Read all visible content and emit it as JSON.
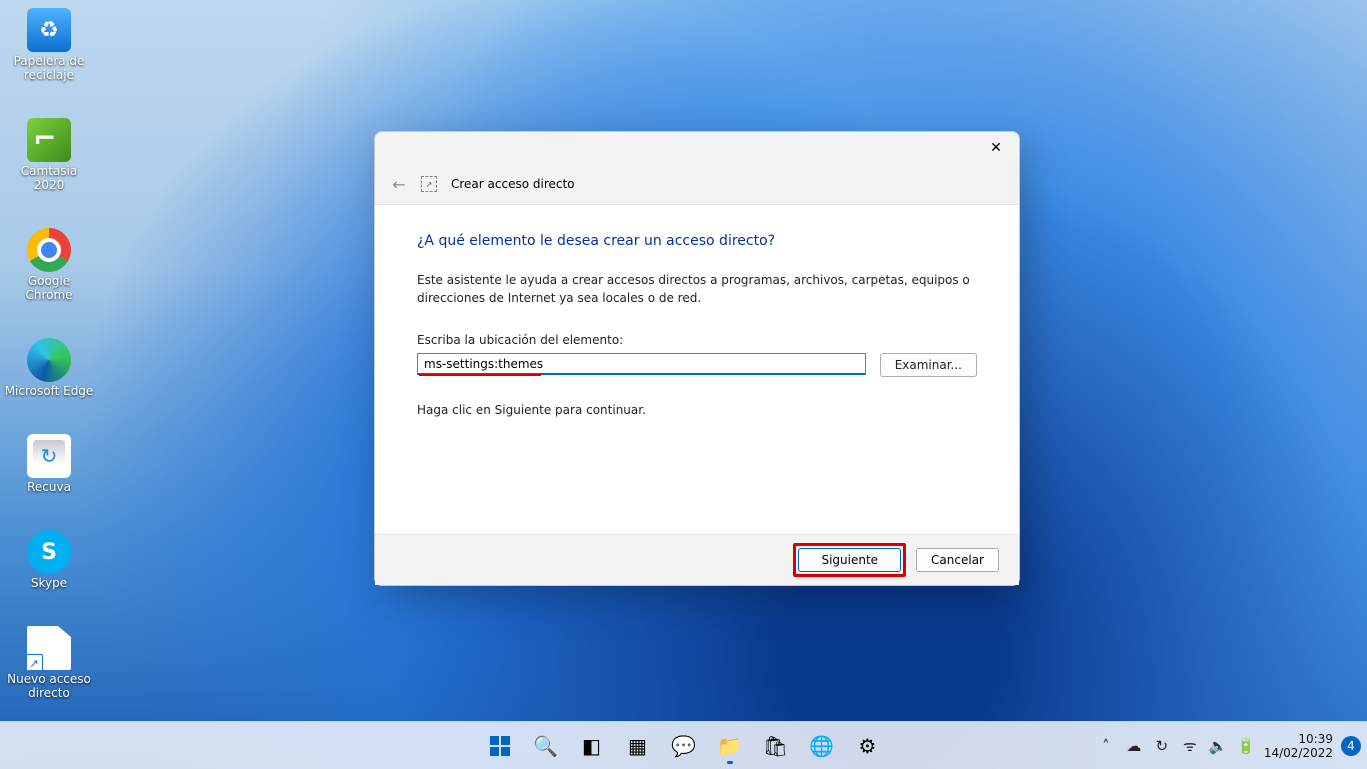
{
  "desktop_icons": [
    {
      "name": "recycle-bin",
      "label": "Papelera de\nreciclaje"
    },
    {
      "name": "camtasia",
      "label": "Camtasia 2020"
    },
    {
      "name": "google-chrome",
      "label": "Google Chrome"
    },
    {
      "name": "microsoft-edge",
      "label": "Microsoft Edge"
    },
    {
      "name": "recuva",
      "label": "Recuva"
    },
    {
      "name": "skype",
      "label": "Skype"
    },
    {
      "name": "new-shortcut",
      "label": "Nuevo acceso\ndirecto"
    }
  ],
  "dialog": {
    "title": "Crear acceso directo",
    "heading": "¿A qué elemento le desea crear un acceso directo?",
    "description": "Este asistente le ayuda a crear accesos directos a programas, archivos, carpetas, equipos o direcciones de Internet ya sea locales o de red.",
    "path_label": "Escriba la ubicación del elemento:",
    "path_value": "ms-settings:themes",
    "browse": "Examinar...",
    "continue_hint": "Haga clic en Siguiente para continuar.",
    "next": "Siguiente",
    "cancel": "Cancelar"
  },
  "taskbar": {
    "items": [
      {
        "name": "start",
        "glyph": "win"
      },
      {
        "name": "search",
        "glyph": "🔍"
      },
      {
        "name": "task-view",
        "glyph": "◧"
      },
      {
        "name": "widgets",
        "glyph": "▦"
      },
      {
        "name": "chat",
        "glyph": "💬"
      },
      {
        "name": "file-explorer",
        "glyph": "📁"
      },
      {
        "name": "ms-store",
        "glyph": "🛍"
      },
      {
        "name": "edge",
        "glyph": "🌐"
      },
      {
        "name": "settings",
        "glyph": "⚙"
      }
    ],
    "tray": {
      "chevron": "˄",
      "onedrive": "☁",
      "update": "↻",
      "wifi": "ᯤ",
      "volume": "🔈",
      "battery": "🔋"
    },
    "clock": {
      "time": "10:39",
      "date": "14/02/2022"
    },
    "notifications": "4"
  }
}
